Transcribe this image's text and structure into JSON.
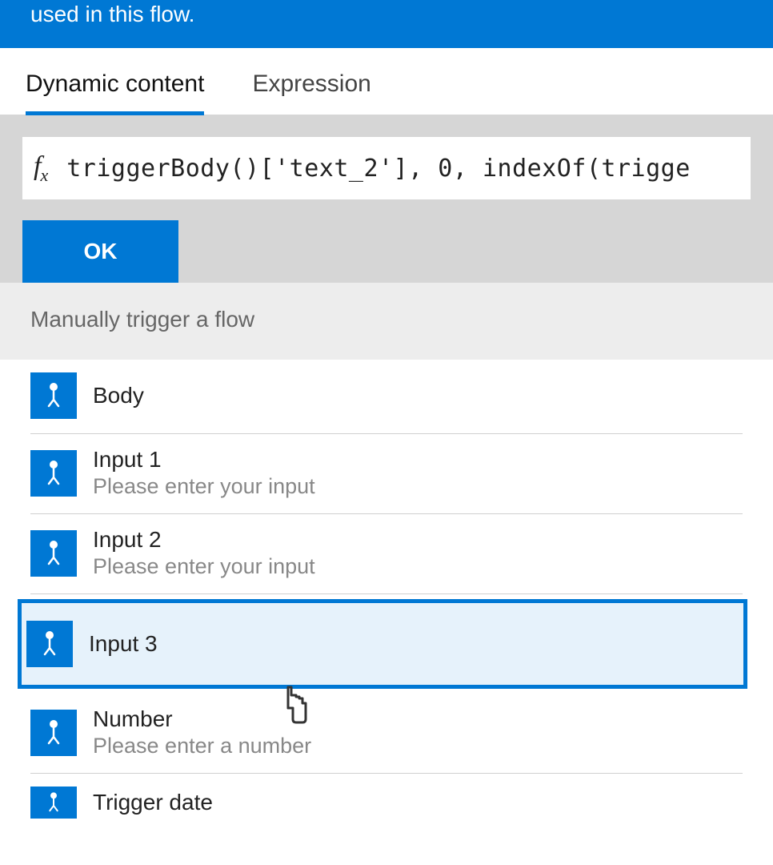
{
  "header": {
    "text": "used in this flow."
  },
  "tabs": {
    "dynamic": "Dynamic content",
    "expression": "Expression",
    "active": "dynamic"
  },
  "formula": {
    "prefix": "fx",
    "text": "triggerBody()['text_2'], 0, indexOf(trigge"
  },
  "ok_label": "OK",
  "section_title": "Manually trigger a flow",
  "items": [
    {
      "title": "Body",
      "desc": ""
    },
    {
      "title": "Input 1",
      "desc": "Please enter your input"
    },
    {
      "title": "Input 2",
      "desc": "Please enter your input"
    },
    {
      "title": "Input 3",
      "desc": "",
      "selected": true
    },
    {
      "title": "Number",
      "desc": "Please enter a number"
    },
    {
      "title": "Trigger date",
      "desc": ""
    }
  ]
}
